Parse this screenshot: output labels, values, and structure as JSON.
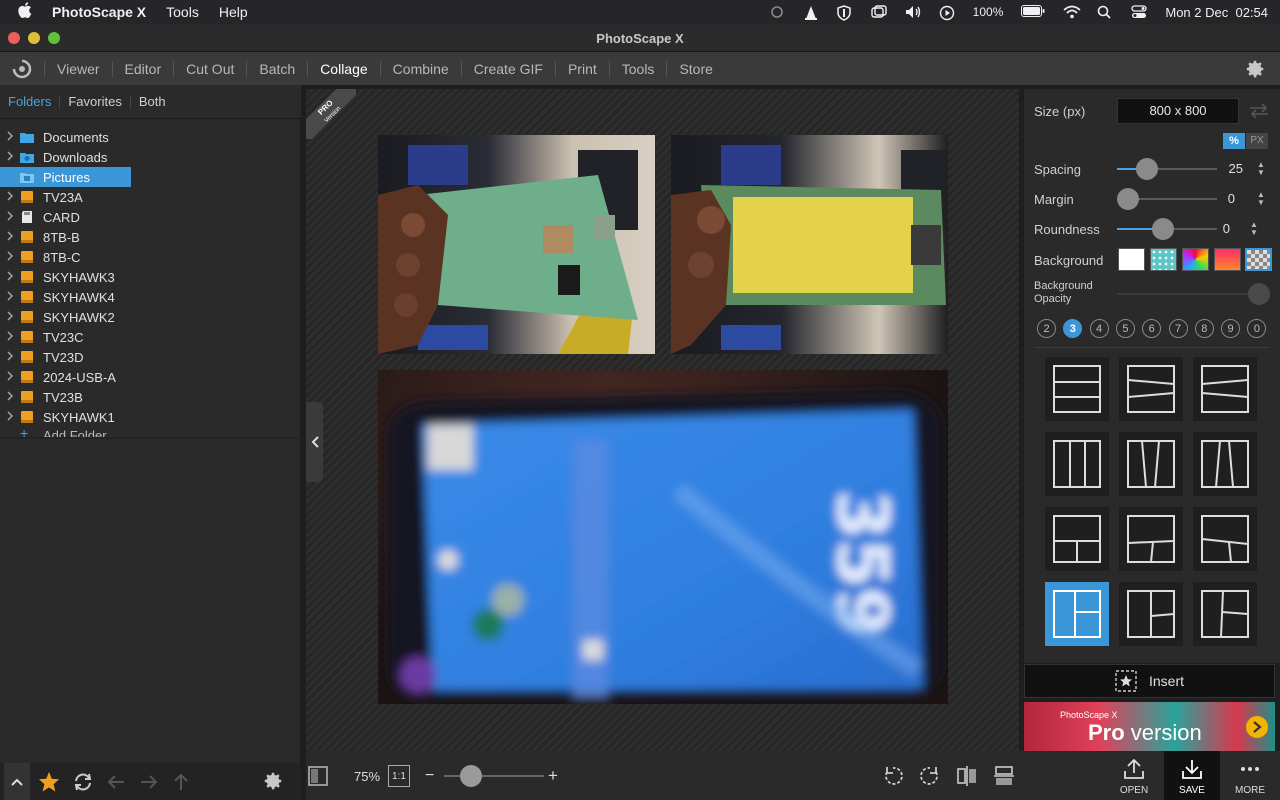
{
  "menubar": {
    "app_name": "PhotoScape X",
    "items": [
      "Tools",
      "Help"
    ],
    "battery": "100%",
    "clock": "Mon 2 Dec  02:54"
  },
  "window": {
    "title": "PhotoScape X"
  },
  "toolbar": {
    "tabs": [
      "Viewer",
      "Editor",
      "Cut Out",
      "Batch",
      "Collage",
      "Combine",
      "Create GIF",
      "Print",
      "Tools",
      "Store"
    ],
    "active_tab": "Collage"
  },
  "sidebar": {
    "tabs": [
      "Folders",
      "Favorites",
      "Both"
    ],
    "active_tab": "Folders",
    "folders": [
      {
        "label": "Documents",
        "icon": "folder-blue-icon"
      },
      {
        "label": "Downloads",
        "icon": "folder-download-icon"
      },
      {
        "label": "Pictures",
        "icon": "folder-pictures-icon",
        "selected": true
      },
      {
        "label": "TV23A",
        "icon": "drive-orange-icon"
      },
      {
        "label": "CARD",
        "icon": "sdcard-icon"
      },
      {
        "label": "8TB-B",
        "icon": "drive-orange-icon"
      },
      {
        "label": "8TB-C",
        "icon": "drive-orange-icon"
      },
      {
        "label": "SKYHAWK3",
        "icon": "drive-orange-icon"
      },
      {
        "label": "SKYHAWK4",
        "icon": "drive-orange-icon"
      },
      {
        "label": "SKYHAWK2",
        "icon": "drive-orange-icon"
      },
      {
        "label": "TV23C",
        "icon": "drive-orange-icon"
      },
      {
        "label": "TV23D",
        "icon": "drive-orange-icon"
      },
      {
        "label": "2024-USB-A",
        "icon": "drive-orange-icon"
      },
      {
        "label": "TV23B",
        "icon": "drive-orange-icon"
      },
      {
        "label": "SKYHAWK1",
        "icon": "drive-orange-icon"
      }
    ],
    "add_folder": "Add Folder"
  },
  "canvas": {
    "pro_ribbon": "PRO",
    "pro_ribbon_sub": "Version"
  },
  "bottombar": {
    "zoom": "75%",
    "one_to_one": "1:1",
    "zoom_level": 0.2,
    "open_label": "OPEN",
    "save_label": "SAVE",
    "more_label": "MORE"
  },
  "panel": {
    "size_label": "Size (px)",
    "size_value": "800 x 800",
    "unit_percent": "%",
    "unit_px": "PX",
    "spacing_label": "Spacing",
    "spacing_value": "25",
    "margin_label": "Margin",
    "margin_value": "0",
    "roundness_label": "Roundness",
    "roundness_value": "0",
    "background_label": "Background",
    "bg_opacity_label_1": "Background",
    "bg_opacity_label_2": "Opacity",
    "photo_counts": [
      "2",
      "3",
      "4",
      "5",
      "6",
      "7",
      "8",
      "9",
      "0"
    ],
    "active_count": "3",
    "insert_label": "Insert",
    "pro_banner_small": "PhotoScape X",
    "pro_banner_big": "Pro",
    "pro_banner_rest": " version"
  },
  "colors": {
    "accent": "#3b96d8",
    "folder_blue": "#3fa7e6",
    "drive_orange": "#f0a020"
  }
}
